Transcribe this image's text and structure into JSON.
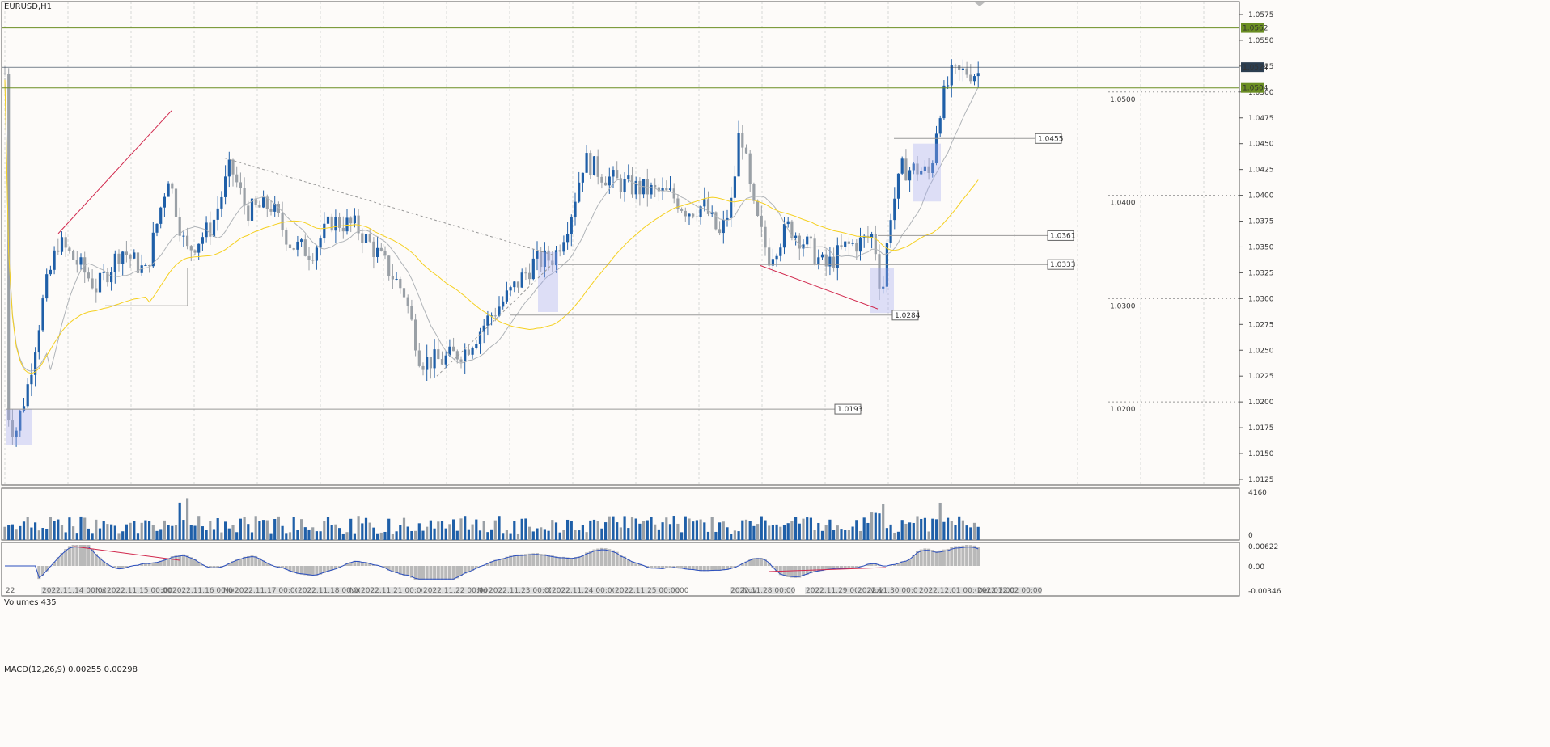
{
  "main": {
    "symbol_title": "EURUSD,H1",
    "price_axis": [
      "1.0575",
      "1.0550",
      "1.0525",
      "1.0500",
      "1.0475",
      "1.0450",
      "1.0425",
      "1.0400",
      "1.0375",
      "1.0350",
      "1.0325",
      "1.0300",
      "1.0275",
      "1.0250",
      "1.0225",
      "1.0200",
      "1.0175",
      "1.0150",
      "1.0125"
    ],
    "hline_tags": [
      {
        "price": 1.0562,
        "text": "1.0562",
        "color": "#6b8e23"
      },
      {
        "price": 1.0524,
        "text": "1.0524",
        "color": "#2c3e50"
      },
      {
        "price": 1.0504,
        "text": "1.0504",
        "color": "#6b8e23"
      }
    ],
    "level_boxes": [
      {
        "price": 1.0455,
        "text": "1.0455"
      },
      {
        "price": 1.0361,
        "text": "1.0361"
      },
      {
        "price": 1.0333,
        "text": "1.0333"
      },
      {
        "price": 1.0284,
        "text": "1.0284"
      },
      {
        "price": 1.0193,
        "text": "1.0193"
      }
    ],
    "round_levels": [
      {
        "price": 1.05,
        "text": "1.0500"
      },
      {
        "price": 1.04,
        "text": "1.0400"
      },
      {
        "price": 1.03,
        "text": "1.0300"
      },
      {
        "price": 1.02,
        "text": "1.0200"
      }
    ]
  },
  "volumes": {
    "title": "Volumes 435",
    "axis": [
      "4160",
      "0"
    ]
  },
  "macd": {
    "title": "MACD(12,26,9) 0.00255 0.00298",
    "axis": [
      "0.00622",
      "0.00",
      "-0.00346"
    ]
  },
  "time_axis": [
    "22",
    "2022.11.14 00:00",
    "Nov",
    "2022.11.15 00:00",
    ":00",
    "2022.11.16 00:00",
    "Nov",
    "2022.11.17 00:00",
    "2022.11.18 00:00",
    "Nov",
    "2022.11.21 00:00",
    "2022.11.22 00:00",
    "Nov",
    "2022.11.23 00:00",
    ":00",
    "2022.11.24 00:00",
    "2022.11.25 00:00",
    ":00",
    "2022.11.28 00:00",
    "Nov",
    "2022.11.29 00:00",
    "2022.11.30 00:00",
    "Nov",
    "2022.12.01 00:00",
    "2022.12.02 00:00",
    "Dec 07:00"
  ],
  "colors": {
    "bull": "#1f5fa8",
    "bear": "#9aa0a6",
    "ma_fast": "#b0b4b8",
    "ma_slow": "#f5d020",
    "trend": "#d1284d",
    "green_line": "#6b8e23",
    "highlight": "rgba(160,170,240,0.35)"
  }
}
